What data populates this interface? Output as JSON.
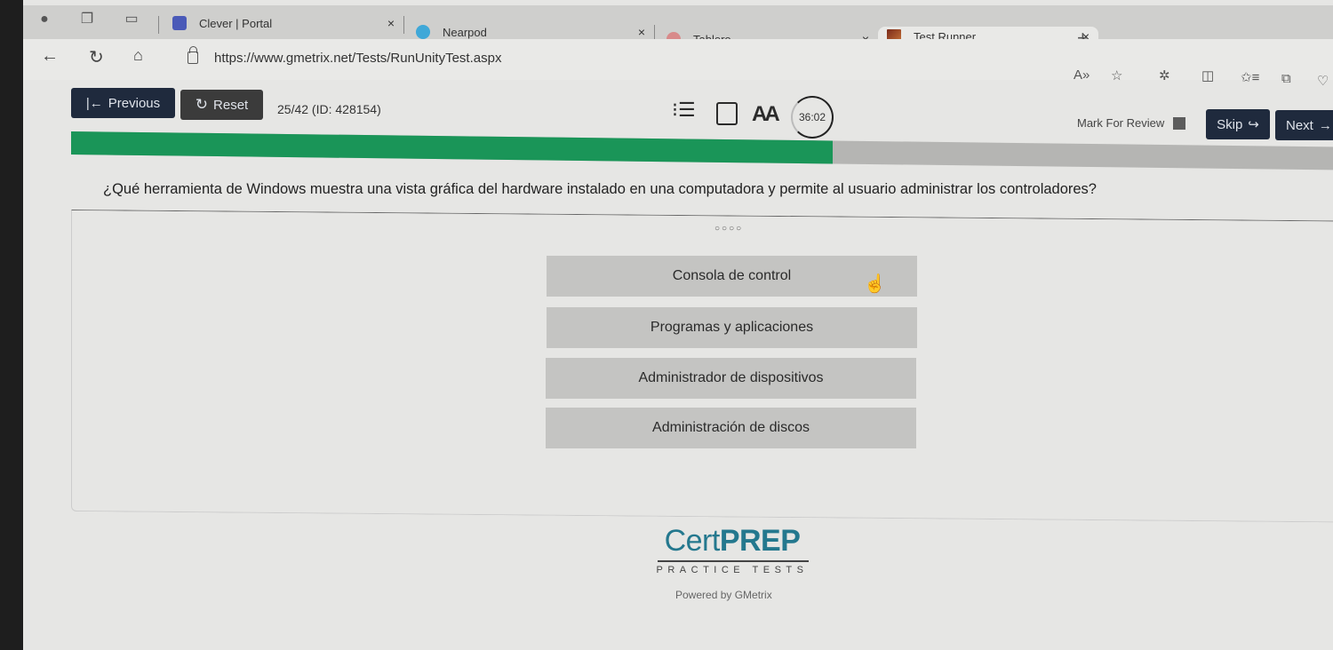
{
  "browser": {
    "tabs": [
      {
        "label": "Clever | Portal",
        "favicon_color": "#4a5ab8",
        "active": false
      },
      {
        "label": "Nearpod",
        "favicon_color": "#3fa8d8",
        "active": false
      },
      {
        "label": "Tablero",
        "favicon_color": "#d88a8a",
        "active": false
      },
      {
        "label": "Test Runner",
        "favicon_color": "#7a2a1a",
        "active": true
      }
    ],
    "close_glyph": "×",
    "new_tab_glyph": "+",
    "url": "https://www.gmetrix.net/Tests/RunUnityTest.aspx"
  },
  "toolbar": {
    "previous_label": "Previous",
    "reset_label": "Reset",
    "question_counter": "25/42 (ID: 428154)",
    "timer": "36:02",
    "mark_for_review_label": "Mark For Review",
    "skip_label": "Skip",
    "next_label": "Next"
  },
  "progress": {
    "current": 25,
    "total": 42,
    "fraction": 0.595
  },
  "question": {
    "text": "¿Qué herramienta de Windows muestra una vista gráfica del hardware instalado en una computadora y permite al usuario administrar los controladores?",
    "answer_indicator": "○○○○",
    "answers": [
      "Consola de control",
      "Programas y aplicaciones",
      "Administrador de dispositivos",
      "Administración de discos"
    ]
  },
  "footer": {
    "logo_light": "Cert",
    "logo_bold": "PREP",
    "logo_tagline": "PRACTICE TESTS",
    "powered_by": "Powered by GMetrix"
  }
}
